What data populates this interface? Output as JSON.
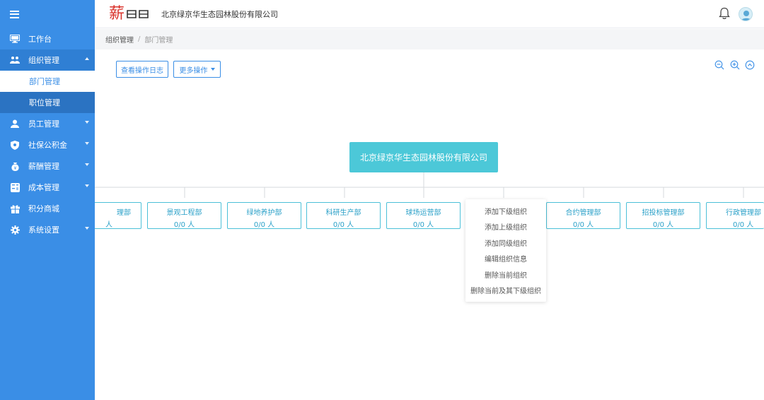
{
  "app": {
    "company": "北京绿京华生态园林股份有限公司",
    "logo_text": "薪"
  },
  "sidebar": {
    "items": [
      {
        "label": "工作台"
      },
      {
        "label": "组织管理",
        "sub": [
          {
            "label": "部门管理"
          },
          {
            "label": "职位管理"
          }
        ]
      },
      {
        "label": "员工管理"
      },
      {
        "label": "社保公积金"
      },
      {
        "label": "薪酬管理"
      },
      {
        "label": "成本管理"
      },
      {
        "label": "积分商城"
      },
      {
        "label": "系统设置"
      }
    ]
  },
  "breadcrumb": {
    "level1": "组织管理",
    "separator": "/",
    "level2": "部门管理"
  },
  "toolbar": {
    "log_label": "查看操作日志",
    "more_label": "更多操作"
  },
  "org": {
    "root": "北京绿京华生态园林股份有限公司",
    "departments": [
      {
        "name": "理部",
        "count": "人"
      },
      {
        "name": "景观工程部",
        "count": "0/0 人"
      },
      {
        "name": "绿地养护部",
        "count": "0/0 人"
      },
      {
        "name": "科研生产部",
        "count": "0/0 人"
      },
      {
        "name": "球场运营部",
        "count": "0/0 人"
      },
      {
        "name": "合约管理部",
        "count": "0/0 人"
      },
      {
        "name": "招投标管理部",
        "count": "0/0 人"
      },
      {
        "name": "行政管理部",
        "count": "0/0 人"
      }
    ]
  },
  "context_menu": {
    "items": [
      "添加下级组织",
      "添加上级组织",
      "添加同级组织",
      "编辑组织信息",
      "删除当前组织",
      "删除当前及其下级组织"
    ]
  },
  "colors": {
    "sidebar": "#3a8ee6",
    "accent": "#3a8ee6",
    "root_node": "#4cc8d8",
    "node_border": "#4cc0d8",
    "logo": "#d9322b"
  }
}
